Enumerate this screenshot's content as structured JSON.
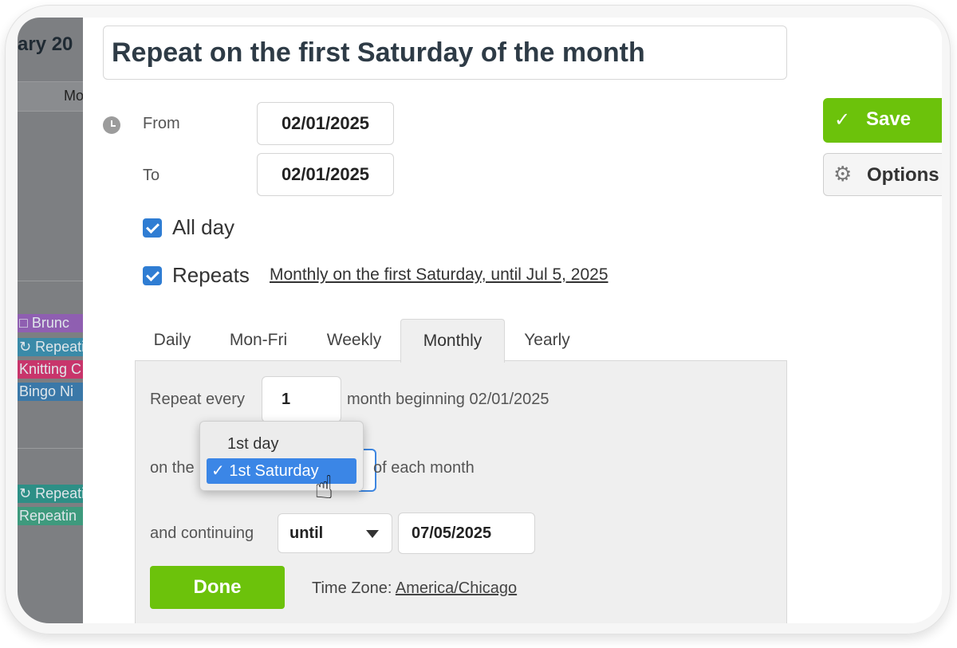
{
  "calendar_bg": {
    "title": "ary 20",
    "day_header": "Mo",
    "events": [
      {
        "label": "□ Brunc",
        "color": "#8f5fb1"
      },
      {
        "label": "↻ Repeatin",
        "color": "#3a8aa8"
      },
      {
        "label": "Knitting C",
        "color": "#c8356b"
      },
      {
        "label": "Bingo Ni",
        "color": "#3a78a8"
      },
      {
        "label": "↻ Repeatin",
        "color": "#2d8f86"
      },
      {
        "label": "Repeatin",
        "color": "#3e9a7d"
      }
    ]
  },
  "event": {
    "title": "Repeat on the first Saturday of the month",
    "from_label": "From",
    "from_date": "02/01/2025",
    "to_label": "To",
    "to_date": "02/01/2025",
    "all_day_label": "All day",
    "repeats_label": "Repeats",
    "repeat_summary": "Monthly on the first Saturday, until Jul 5, 2025"
  },
  "tabs": [
    "Daily",
    "Mon-Fri",
    "Weekly",
    "Monthly",
    "Yearly"
  ],
  "active_tab": "Monthly",
  "monthly": {
    "repeat_every_label": "Repeat every",
    "interval": "1",
    "beginning_text": "month beginning 02/01/2025",
    "on_the_label": "on the",
    "each_month_label": "of each month",
    "options": [
      "1st day",
      "1st Saturday"
    ],
    "selected_option": "✓ 1st Saturday",
    "continuing_label": "and continuing",
    "end_mode": "until",
    "end_date": "07/05/2025"
  },
  "done_label": "Done",
  "timezone_label": "Time Zone:",
  "timezone_value": "America/Chicago",
  "save_label": "Save",
  "options_label": "Options",
  "icons": {
    "save": "check-icon",
    "options": "gear-icon",
    "time": "clock-icon"
  },
  "colors": {
    "accent_green": "#6cc20b",
    "checkbox_blue": "#2f7dd3",
    "selection_blue": "#3b86e6"
  }
}
